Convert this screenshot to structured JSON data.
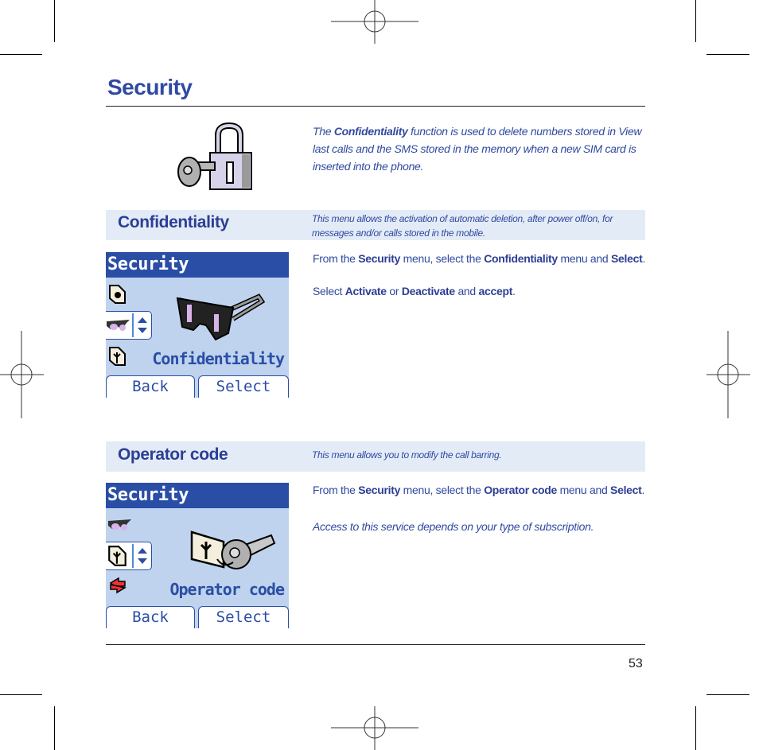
{
  "page": {
    "title": "Security",
    "page_number": "53"
  },
  "intro": {
    "pre": "The ",
    "bold": "Confidentiality",
    "post": " function is used to delete numbers stored in View last calls and the SMS stored in the memory when a new SIM card is inserted into the phone.",
    "icon": "padlock-with-key-icon"
  },
  "sections": [
    {
      "title": "Confidentiality",
      "description": "This menu allows the activation of automatic deletion, after power off/on, for messages and/or calls stored in the mobile.",
      "phone": {
        "header": "Security",
        "selected_label": "Confidentiality",
        "icons": [
          "address-book-icon",
          "glasses-icon",
          "phone-book-icon"
        ],
        "main_icon": "sunglasses-icon",
        "softkeys": [
          "Back",
          "Select"
        ]
      },
      "instructions": {
        "p1": [
          "From the ",
          "Security",
          " menu, select the ",
          "Confidentiality",
          " menu and ",
          "Select",
          "."
        ],
        "p2": [
          "Select ",
          "Activate",
          " or ",
          "Deactivate",
          " and ",
          "accept",
          "."
        ]
      }
    },
    {
      "title": "Operator code",
      "description": "This menu allows you to modify the call barring.",
      "phone": {
        "header": "Security",
        "selected_label": "Operator code",
        "icons": [
          "glasses-icon",
          "phone-book-icon",
          "operator-arrows-icon"
        ],
        "main_icon": "card-and-key-icon",
        "softkeys": [
          "Back",
          "Select"
        ]
      },
      "instructions": {
        "p1": [
          "From the ",
          "Security",
          " menu, select the ",
          "Operator code",
          " menu and ",
          "Select",
          "."
        ],
        "note": "Access to this service depends on your type of subscription."
      }
    }
  ],
  "colors": {
    "title_blue": "#2f4aa0",
    "band_bg": "#e3ebf7",
    "screen_bg": "#bfd3ee",
    "screen_header": "#2a4ea5"
  }
}
